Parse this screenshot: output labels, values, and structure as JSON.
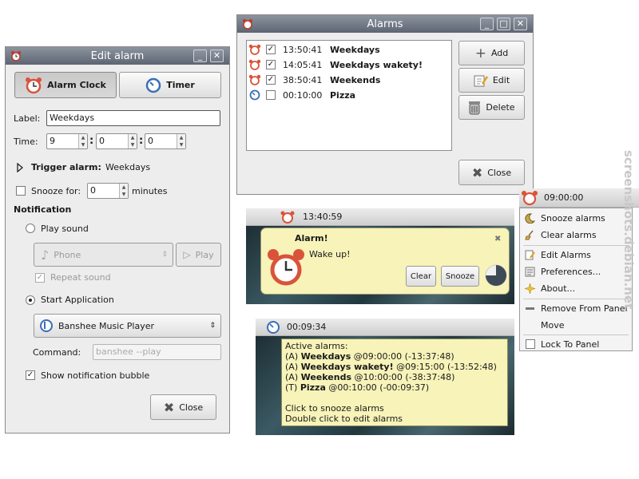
{
  "edit_alarm": {
    "title": "Edit alarm",
    "tabs": [
      {
        "label": "Alarm Clock"
      },
      {
        "label": "Timer"
      }
    ],
    "label_caption": "Label:",
    "label_value": "Weekdays",
    "time_caption": "Time:",
    "time": {
      "h": "9",
      "m": "0",
      "s": "0"
    },
    "trigger_caption": "Trigger alarm:",
    "trigger_value": "Weekdays",
    "snooze_caption": "Snooze for:",
    "snooze_value": "0",
    "snooze_unit": "minutes",
    "notification_heading": "Notification",
    "play_sound_label": "Play sound",
    "sound_select": "Phone",
    "play_button": "Play",
    "repeat_label": "Repeat sound",
    "start_app_label": "Start Application",
    "app_select": "Banshee Music Player",
    "command_caption": "Command:",
    "command_placeholder": "banshee --play",
    "bubble_label": "Show notification bubble",
    "close_button": "Close"
  },
  "alarms_window": {
    "title": "Alarms",
    "rows": [
      {
        "time": "13:50:41",
        "name": "Weekdays",
        "checked": true,
        "icon": "alarm-clock-icon"
      },
      {
        "time": "14:05:41",
        "name": "Weekdays wakety!",
        "checked": true,
        "icon": "alarm-clock-icon"
      },
      {
        "time": "38:50:41",
        "name": "Weekends",
        "checked": true,
        "icon": "alarm-clock-icon"
      },
      {
        "time": "00:10:00",
        "name": "Pizza",
        "checked": false,
        "icon": "timer-icon"
      }
    ],
    "add_button": "Add",
    "edit_button": "Edit",
    "delete_button": "Delete",
    "close_button": "Close"
  },
  "applet_menu": {
    "panel_time": "09:00:00",
    "items": [
      "Snooze alarms",
      "Clear alarms",
      "Edit Alarms",
      "Preferences...",
      "About...",
      "Remove From Panel",
      "Move",
      "Lock To Panel"
    ]
  },
  "notify": {
    "panel_time": "13:40:59",
    "title": "Alarm!",
    "body": "Wake up!",
    "clear_button": "Clear",
    "snooze_button": "Snooze"
  },
  "tooltip_panel": {
    "panel_time": "00:09:34",
    "heading": "Active alarms:",
    "lines": [
      {
        "prefix": "(A) ",
        "name": "Weekdays",
        "rest": " @09:00:00 (-13:37:48)"
      },
      {
        "prefix": "(A) ",
        "name": "Weekdays wakety!",
        "rest": " @09:15:00 (-13:52:48)"
      },
      {
        "prefix": "(A) ",
        "name": "Weekends",
        "rest": " @10:00:00 (-38:37:48)"
      },
      {
        "prefix": "(T) ",
        "name": "Pizza",
        "rest": " @00:10:00 (-00:09:37)"
      }
    ],
    "hint1": "Click to snooze alarms",
    "hint2": "Double click to edit alarms"
  },
  "watermark": "screenshots.debian.net",
  "colors": {
    "titlebar": "#6f7782",
    "tooltip": "#f7f3b9",
    "alarm_red": "#d9533a",
    "timer_blue": "#3b6fb5"
  }
}
